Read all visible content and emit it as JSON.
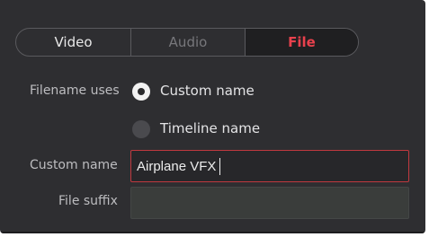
{
  "tabs": [
    {
      "label": "Video",
      "active": false
    },
    {
      "label": "Audio",
      "active": false
    },
    {
      "label": "File",
      "active": true
    }
  ],
  "filename_uses": {
    "label": "Filename uses",
    "options": [
      {
        "label": "Custom name",
        "selected": true
      },
      {
        "label": "Timeline name",
        "selected": false
      }
    ]
  },
  "custom_name": {
    "label": "Custom name",
    "value": "Airplane VFX"
  },
  "file_suffix": {
    "label": "File suffix",
    "value": ""
  },
  "colors": {
    "panel_bg": "#2e2e31",
    "active_tab_text": "#e8414d",
    "focus_border": "#c0393f"
  }
}
